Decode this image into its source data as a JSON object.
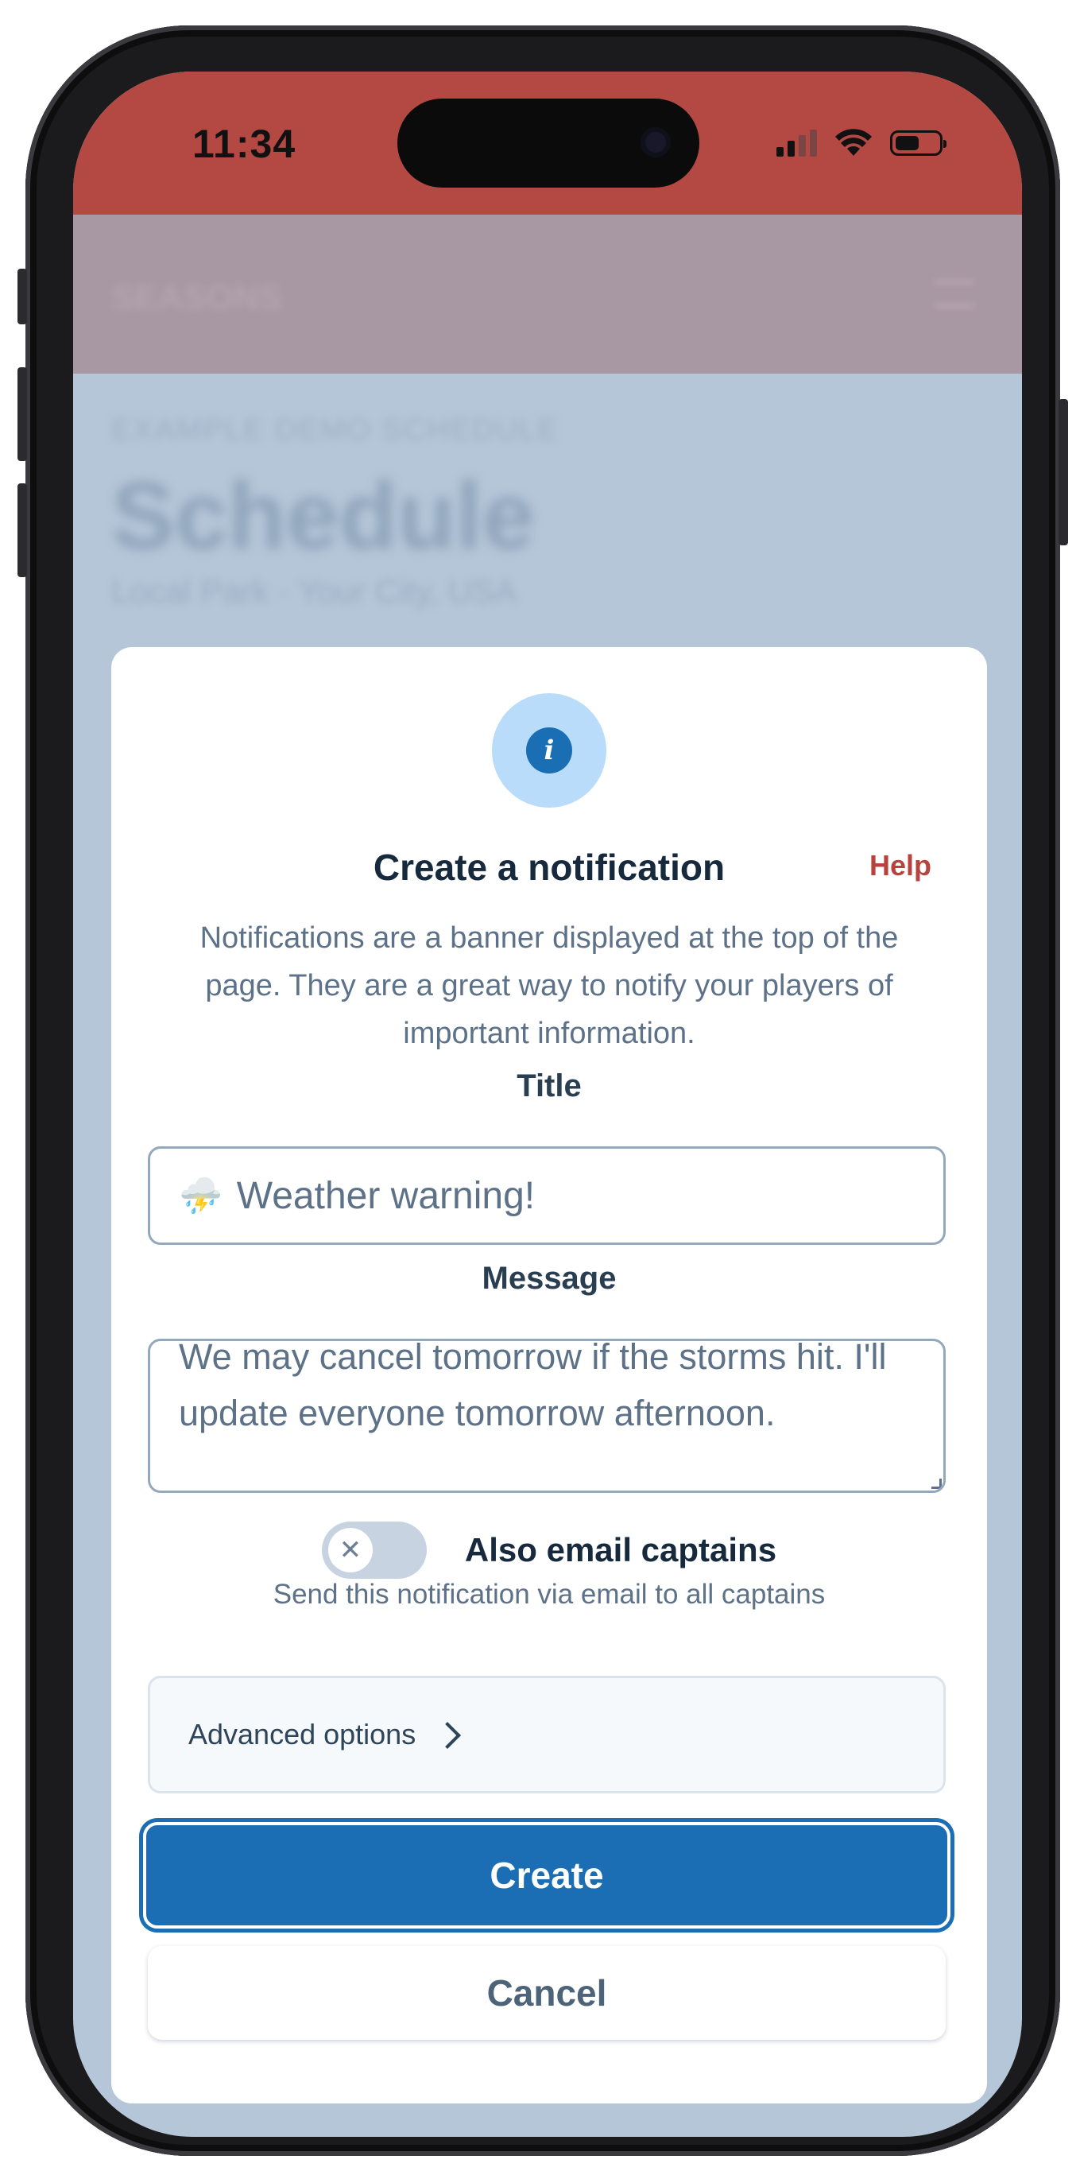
{
  "status_bar": {
    "time": "11:34",
    "signal": "cellular-signal-icon",
    "wifi": "wifi-icon",
    "battery": "battery-icon",
    "battery_level": 0.55
  },
  "background_page": {
    "logo": "SEASONS",
    "breadcrumb": "EXAMPLE DEMO SCHEDULE",
    "title": "Schedule",
    "subtitle": "Local Park · Your City, USA"
  },
  "modal": {
    "icon": "info-icon",
    "title": "Create a notification",
    "help": "Help",
    "description": "Notifications are a banner displayed at the top of the page. They are a great way to notify your players of important information.",
    "title_field": {
      "label": "Title",
      "emoji": "⛈️",
      "value": "Weather warning!"
    },
    "message_field": {
      "label": "Message",
      "value": "We may cancel tomorrow if the storms hit. I'll update everyone tomorrow afternoon."
    },
    "email_toggle": {
      "label": "Also email captains",
      "sub": "Send this notification via email to all captains",
      "state": "off",
      "knob_glyph": "✕"
    },
    "advanced": {
      "label": "Advanced options"
    },
    "create_label": "Create",
    "cancel_label": "Cancel"
  },
  "colors": {
    "status_bar": "#b44943",
    "primary": "#1b6eb3",
    "help": "#b8433e",
    "overlay": "#b5c6d8"
  }
}
